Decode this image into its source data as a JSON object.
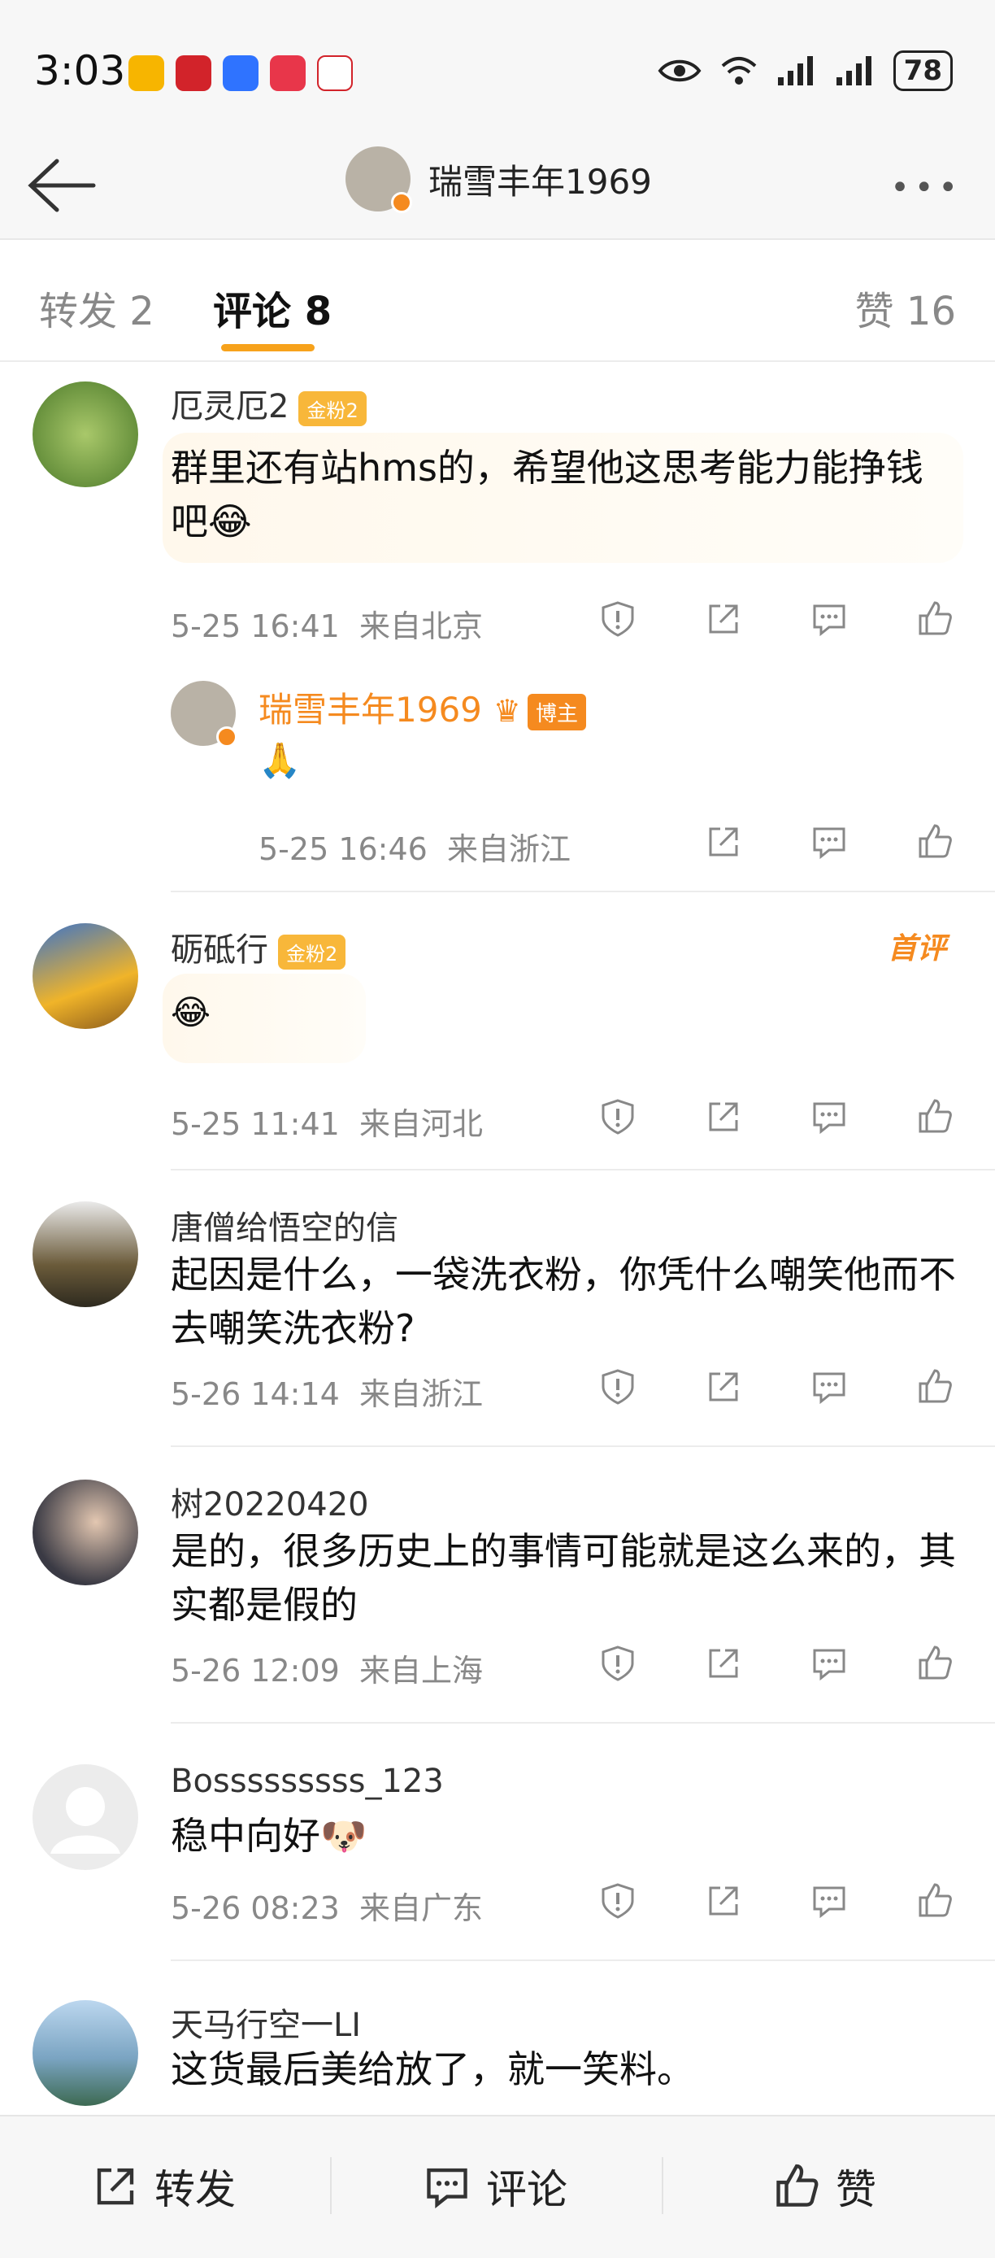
{
  "status_bar": {
    "time": "3:03",
    "battery": "78"
  },
  "nav": {
    "title": "瑞雪丰年1969"
  },
  "tabs": [
    {
      "label": "转发 2"
    },
    {
      "label": "评论 8"
    },
    {
      "label": "赞 16"
    }
  ],
  "comments": [
    {
      "user": "厄灵厄2",
      "badge": "金粉2",
      "text": "群里还有站hms的，希望他这思考能力能挣钱吧😂",
      "time": "5-25 16:41",
      "location": "来自北京"
    },
    {
      "user": "砺砥行",
      "badge": "金粉2",
      "text": "😂",
      "time": "5-25 11:41",
      "location": "来自河北",
      "first_comment": "首评"
    },
    {
      "user": "唐僧给悟空的信",
      "text": "起因是什么，一袋洗衣粉，你凭什么嘲笑他而不去嘲笑洗衣粉?",
      "time": "5-26 14:14",
      "location": "来自浙江"
    },
    {
      "user": "树20220420",
      "text": "是的，很多历史上的事情可能就是这么来的，其实都是假的",
      "time": "5-26 12:09",
      "location": "来自上海"
    },
    {
      "user": "Bosssssssss_123",
      "text": "稳中向好🐶",
      "time": "5-26 08:23",
      "location": "来自广东"
    },
    {
      "user": "天马行空一LI",
      "text": "这货最后美给放了，就一笑料。"
    }
  ],
  "reply": {
    "user": "瑞雪丰年1969",
    "tag": "博主",
    "text": "🙏",
    "time": "5-25 16:46",
    "location": "来自浙江"
  },
  "bottom_bar": {
    "repost": "转发",
    "comment": "评论",
    "like": "赞"
  }
}
